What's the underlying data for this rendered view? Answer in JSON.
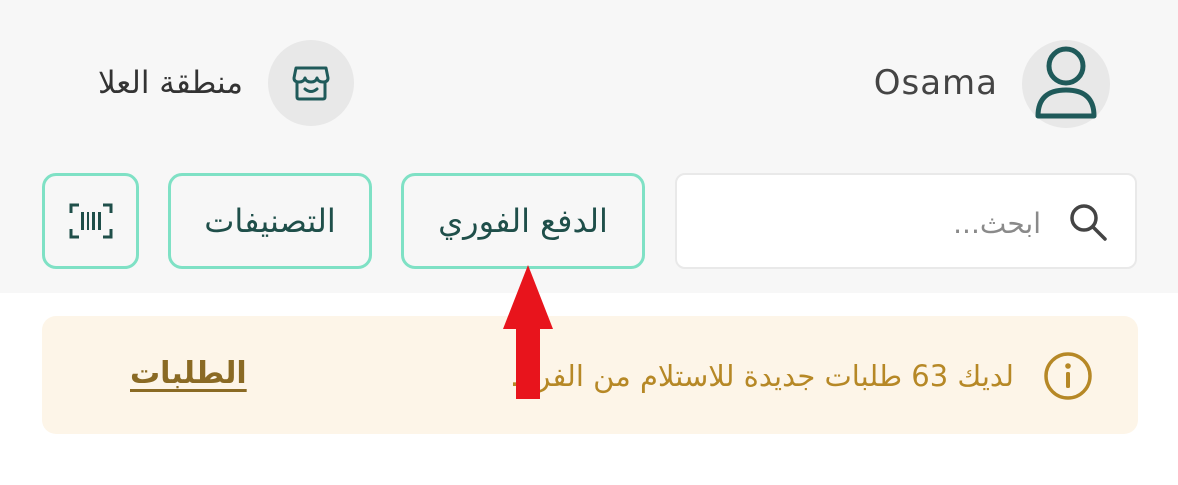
{
  "header": {
    "user_name": "Osama",
    "user_icon": "user-icon",
    "region_name": "منطقة العلا",
    "store_icon": "store-icon"
  },
  "toolbar": {
    "search": {
      "placeholder": "ابحث...",
      "value": "",
      "icon": "search-icon"
    },
    "instant_pay_label": "الدفع الفوري",
    "categories_label": "التصنيفات",
    "scan_icon": "barcode-scan-icon"
  },
  "notice": {
    "icon": "info-icon",
    "message": "لديك 63 طلبات جديدة للاستلام من الفرع.",
    "link_label": "الطلبات"
  },
  "annotation": {
    "icon": "arrow-up-icon",
    "color": "#e8141c"
  },
  "colors": {
    "accent_border": "#7fe1c5",
    "icon_teal": "#1f5a5a",
    "notice_text": "#b68826",
    "notice_bg": "#fdf5e8"
  }
}
